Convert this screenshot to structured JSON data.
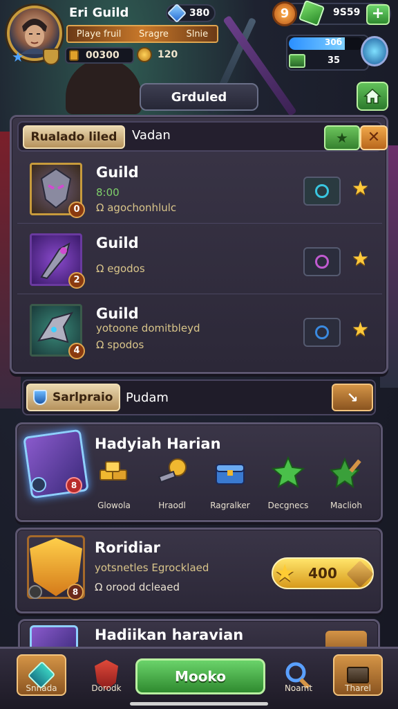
{
  "player": {
    "name": "Eri Guild",
    "gems": "380",
    "tags": [
      "Playe fruil",
      "Sragre",
      "Slnie"
    ],
    "coins": "00300",
    "coins2": "120"
  },
  "resources": {
    "gold_symbol": "9",
    "value": "9S59",
    "add": "+",
    "energy_top": "30б",
    "energy_bottom": "35",
    "energy_fill": 0.75
  },
  "header": {
    "title": "Grduled"
  },
  "guild_panel": {
    "tab_active": "Rualado liled",
    "tab_label": "Vadan",
    "btn_green": "★",
    "btn_close": "✕",
    "guilds": [
      {
        "name": "Guild",
        "line1": "8:00",
        "line2": "Ω agochonhlulc",
        "level": "0",
        "join_color": "#39c6e0",
        "emblem_color": "#c8782a"
      },
      {
        "name": "Guild",
        "line1": "",
        "line2": "Ω egodos",
        "level": "2",
        "join_color": "#c05ad0",
        "emblem_color": "#6a3aa0"
      },
      {
        "name": "Guild",
        "line1": "yotoone domitbleyd",
        "line2": "Ω spodos",
        "level": "4",
        "join_color": "#3a8ae0",
        "emblem_color": "#2a6a6a"
      }
    ]
  },
  "search": {
    "tab": "Sarlpraio",
    "label": "Pudam",
    "go": "↘"
  },
  "daily": {
    "title": "Hadyiah Harian",
    "badge": "8",
    "rewards": [
      {
        "label": "Glowola",
        "icon": "gold-bars-icon",
        "color": "#e0a12a"
      },
      {
        "label": "Hraodl",
        "icon": "key-icon",
        "color": "#d49446"
      },
      {
        "label": "Ragralker",
        "icon": "chest-icon",
        "color": "#3a7ad0"
      },
      {
        "label": "Decgnecs",
        "icon": "green-star-icon",
        "color": "#4ac04a"
      },
      {
        "label": "Maclioh",
        "icon": "green-star-sword-icon",
        "color": "#3aa03a"
      }
    ]
  },
  "quest": {
    "title": "Roridiar",
    "line1": "yotsnetles Egrocklaed",
    "line2": "Ω orood dcleaed",
    "badge": "8",
    "reward": "400"
  },
  "peek": {
    "title": "Hadiikan haravian"
  },
  "nav": {
    "left": "Snnada",
    "left2": "Dorodk",
    "main": "Mooko",
    "right2": "Noamt",
    "right": "Tharel"
  }
}
